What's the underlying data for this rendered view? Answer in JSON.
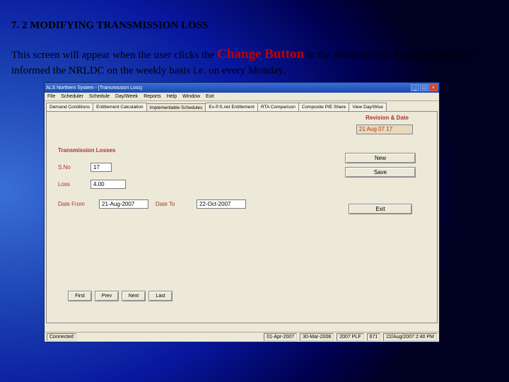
{
  "doc": {
    "heading": "7. 2  MODIFYING TRANSMISSION LOSS",
    "para_before": "This screen will appear when the user clicks the ",
    "change_button": "Change Button",
    "para_after": " in the above screen. Transmission Loss is informed the NRLDC on the weekly basis i.e. on every Monday."
  },
  "window": {
    "title": "ALS Northern System - [Transmission Loss]",
    "menus": [
      "File",
      "Scheduler",
      "Schedule",
      "Day/Week",
      "Reports",
      "Help",
      "Window",
      "Exit"
    ],
    "tabs": [
      "Demand Conditions",
      "Entitlement Calculation",
      "Implementable Schedules",
      "Ex-P.S.net Entitlement",
      "RTA Comparison",
      "Composite PIE Share",
      "View Day/Wise"
    ],
    "revision_label": "Revision & Date",
    "revision_value": "21 Aug 07   17",
    "group_title": "Transmission Losses",
    "sno_label": "S.No",
    "sno_value": "17",
    "loss_label": "Loss",
    "loss_value": "4.00",
    "date_from_label": "Date From",
    "date_from_value": "21-Aug-2007",
    "date_to_label": "Date To",
    "date_to_value": "22-Oct-2007",
    "buttons": {
      "new": "New",
      "save": "Save",
      "exit": "Exit",
      "first": "First",
      "prev": "Prev",
      "next": "Next",
      "last": "Last"
    },
    "status": {
      "connected": "Connected",
      "d1": "01-Apr-2007",
      "d2": "30-Mar-2008",
      "d3": "2007 PLF",
      "d4": "671",
      "d5": "22/Aug/2007 2:40 PM"
    }
  }
}
